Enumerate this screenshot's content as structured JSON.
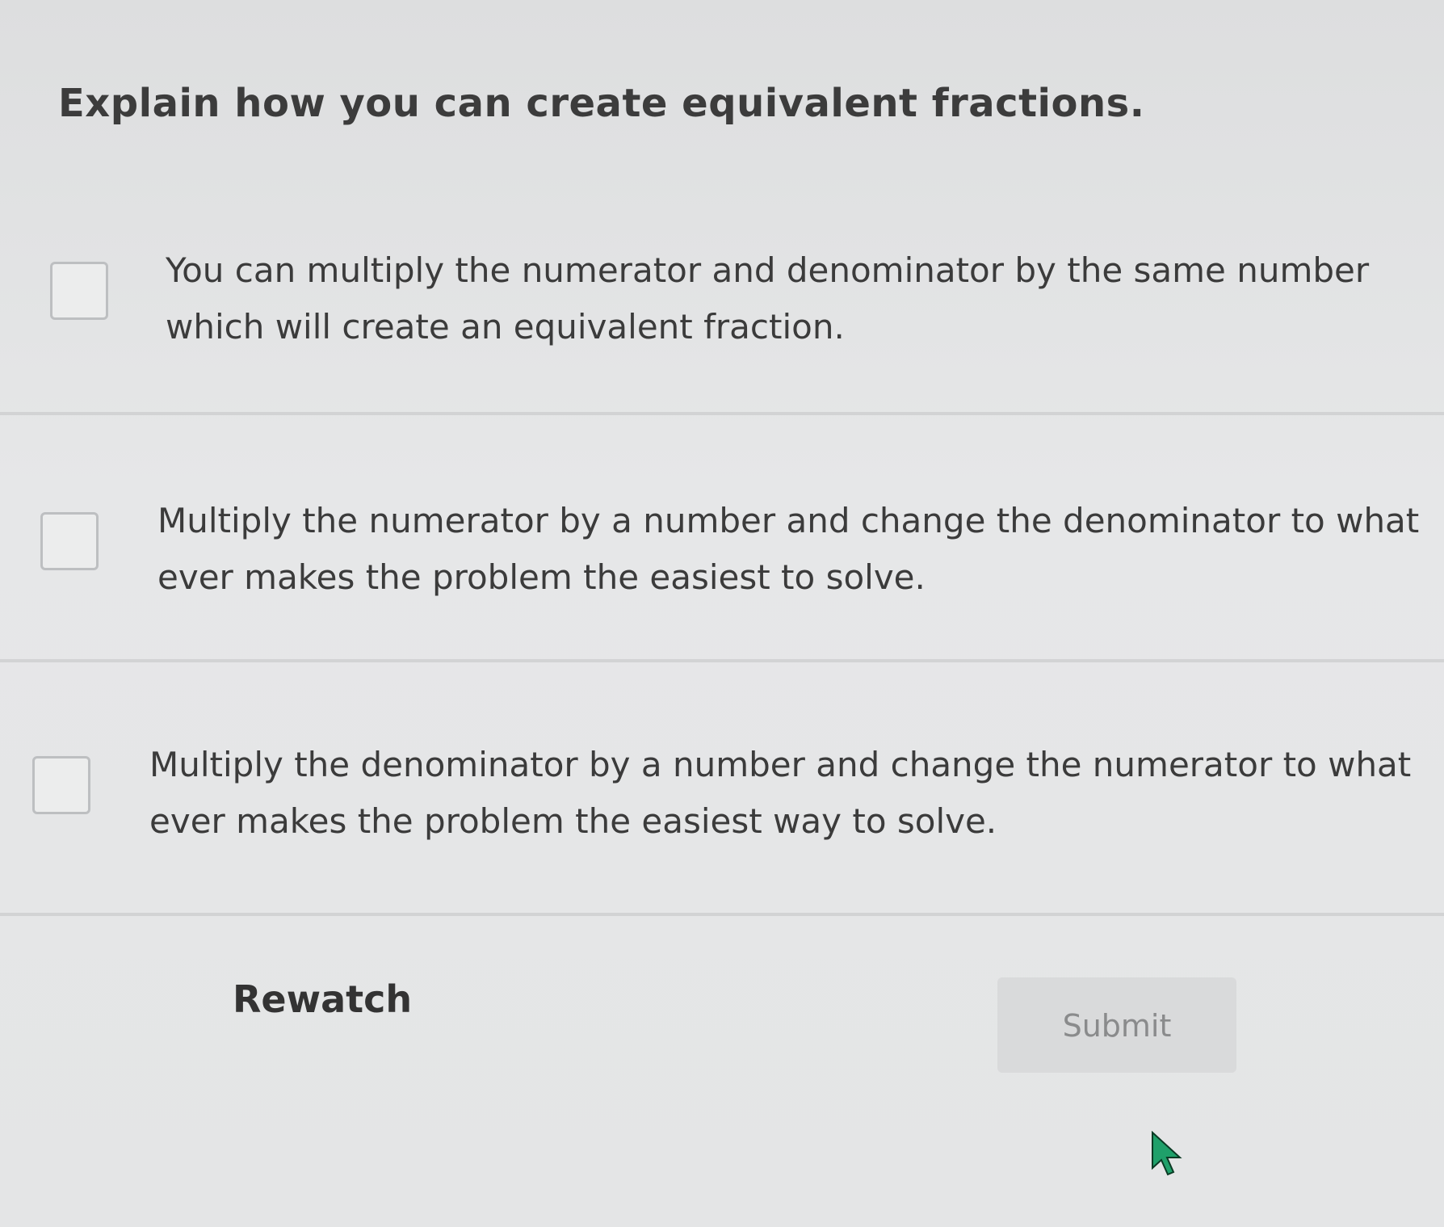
{
  "question": {
    "text": "Explain how you can create equivalent fractions."
  },
  "options": [
    {
      "text": "You can multiply the numerator and denominator by the same number which will create an equivalent fraction.",
      "checked": false
    },
    {
      "text": "Multiply the numerator by a number and change the denominator to what ever makes the problem the easiest to solve.",
      "checked": false
    },
    {
      "text": "Multiply the denominator by a number and change the numerator to what ever makes the problem the easiest way to solve.",
      "checked": false
    }
  ],
  "footer": {
    "rewatch_label": "Rewatch",
    "submit_label": "Submit"
  },
  "colors": {
    "background": "#e3e4e5",
    "submit_bg": "#d9dadb",
    "cursor": "#1fa06a"
  }
}
